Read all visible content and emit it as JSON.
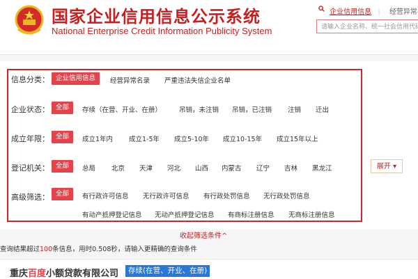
{
  "header": {
    "title": "国家企业信用信息公示系统",
    "subtitle": "National Enterprise Credit Information Publicity System",
    "links": [
      "企业信用信息",
      "经营异常名"
    ],
    "search_placeholder": "请输入企业名称、统一社会信用代码"
  },
  "filters": {
    "category": {
      "label": "信息分类：",
      "active": "企业信用信息",
      "options": [
        "经营异常名录",
        "严重违法失信企业名单"
      ]
    },
    "status": {
      "label": "企业状态：",
      "active": "全部",
      "options": [
        "存续（在营、开业、在册）",
        "吊销，未注销",
        "吊销，已注销",
        "注销",
        "迁出"
      ]
    },
    "years": {
      "label": "成立年限：",
      "active": "全部",
      "options": [
        "成立1年内",
        "成立1-5年",
        "成立5-10年",
        "成立10-15年",
        "成立15年以上"
      ]
    },
    "authority": {
      "label": "登记机关：",
      "active": "全部",
      "options": [
        "总局",
        "北京",
        "天津",
        "河北",
        "山西",
        "内蒙古",
        "辽宁",
        "吉林",
        "黑龙江"
      ]
    },
    "advanced": {
      "label": "高级筛选：",
      "active": "全部",
      "options_row1": [
        "有行政许可信息",
        "无行政许可信息",
        "有行政处罚信息",
        "无行政处罚信息"
      ],
      "options_row2": [
        "有动产抵押登记信息",
        "无动产抵押登记信息",
        "有商标注册信息",
        "无商标注册信息"
      ]
    },
    "expand_label": "展开",
    "collapse_label": "收起筛选条件"
  },
  "result": {
    "prefix": "查询结果超过",
    "count": "100",
    "middle": "条信息，用时",
    "time": "0.508",
    "suffix": "秒，请输入更精确的查询条件"
  },
  "company": {
    "name_before": "重庆",
    "name_highlight": "百度",
    "name_after": "小额贷款有限公司",
    "status": "存续(在营、开业、在册)"
  },
  "colors": {
    "brand_red": "#c81e1e",
    "active_bg": "#e5434b",
    "status_blue": "#2a78d6",
    "frame_red": "#d2232a"
  }
}
